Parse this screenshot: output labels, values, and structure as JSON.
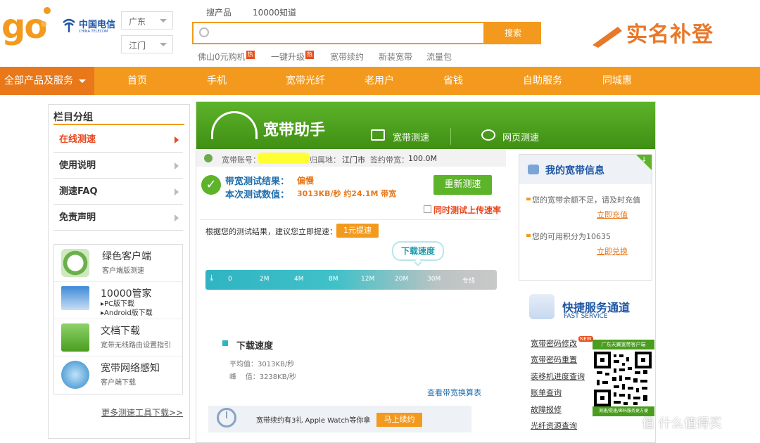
{
  "header": {
    "logo_text": "go",
    "carrier_name": "中国电信",
    "carrier_en": "CHINA TELECOM",
    "province": "广东",
    "city": "江门",
    "top_links": [
      "搜产品",
      "10000知道"
    ],
    "search_placeholder": "",
    "search_button": "搜索",
    "hot_links": [
      {
        "label": "佛山0元购机",
        "badge": "热"
      },
      {
        "label": "一键升级",
        "badge": "热"
      },
      {
        "label": "宽带续约"
      },
      {
        "label": "新装宽带"
      },
      {
        "label": "流量包"
      }
    ],
    "banner": "实名补登"
  },
  "nav": {
    "all": "全部产品及服务",
    "items": [
      "首页",
      "手机",
      "宽带光纤",
      "老用户",
      "省钱",
      "自助服务",
      "同城惠"
    ]
  },
  "sidebar": {
    "title": "栏目分组",
    "items": [
      "在线测速",
      "使用说明",
      "测速FAQ",
      "免责声明"
    ],
    "tools": [
      {
        "title": "绿色客户端",
        "sub": "客户端版测速"
      },
      {
        "title": "10000管家",
        "sub": "▸PC版下载",
        "sub2": "▸Android版下载"
      },
      {
        "title": "文档下载",
        "sub": "宽带无线路由设置指引"
      },
      {
        "title": "宽带网络感知",
        "sub": "客户端下载"
      }
    ],
    "more": "更多测速工具下载>>"
  },
  "main": {
    "title": "宽带助手",
    "tabs": [
      "宽带测速",
      "网页测速"
    ],
    "account_label": "宽带账号：",
    "region_label": "归属地：",
    "region": "江门市",
    "signed_label": "签约带宽：",
    "signed": "100.0M",
    "result_label": "带宽测试结果：",
    "result_value": "偏慢",
    "measure_label": "本次测试数值：",
    "measure_value": "3013KB/秒  约24.1M  带宽",
    "retest": "重新测速",
    "upload_label": "同时测试上传速率",
    "suggest": "根据您的测试结果，建议您立即提速：",
    "speedup": "1元提速",
    "bubble": "下载速度",
    "ticks": [
      "0",
      "2M",
      "4M",
      "8M",
      "12M",
      "20M",
      "30M",
      "专线"
    ],
    "dl_title": "下载速度",
    "avg": "平均值：3013KB/秒",
    "peak": "峰    值：3238KB/秒",
    "calc_link": "查看带宽换算表",
    "renew_text": "宽带续约有3礼 Apple Watch等你拿",
    "renew_btn": "马上续约"
  },
  "right": {
    "info_title": "我的宽带信息",
    "info1": "您的宽带余额不足，请及时充值",
    "link1": "立即充值",
    "info2": "您的可用积分为10635",
    "link2": "立即兑换",
    "fast_title": "快捷服务通道",
    "fast_en": "FAST SERVICE",
    "services": [
      "宽带密码修改",
      "宽带密码重置",
      "装移机进度查询",
      "账单查询",
      "故障报修",
      "光纤资源查询"
    ],
    "new_badge": "NEW",
    "qr_head": "广东天翼宽带客户端",
    "qr_foot": "测速/提速/密码服务更方便"
  },
  "watermark": "值 什么值得买"
}
